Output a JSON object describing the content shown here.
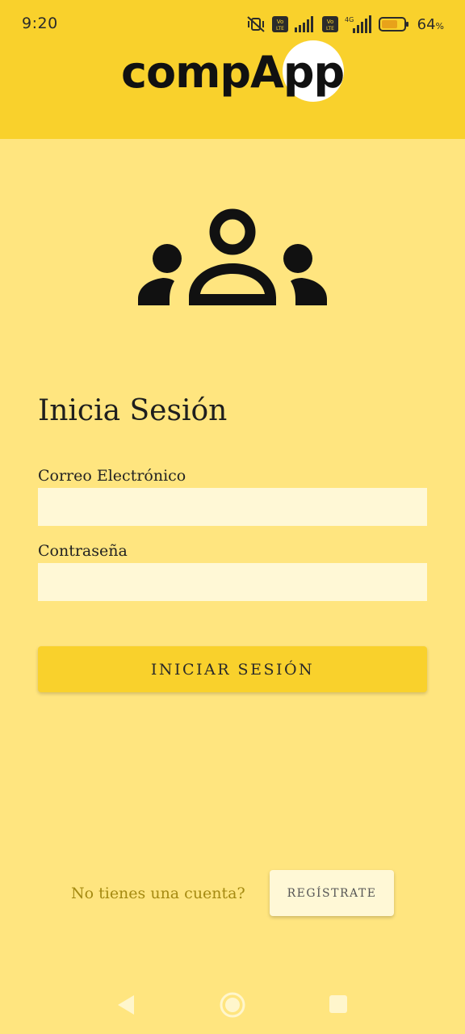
{
  "status_bar": {
    "time": "9:20",
    "battery_percent": "64",
    "battery_suffix": "%",
    "icons": [
      "mute-vibrate-icon",
      "volte-icon",
      "signal-icon",
      "volte-icon",
      "4g-signal-icon",
      "battery-icon"
    ]
  },
  "header": {
    "logo_text": "compApp",
    "background_color": "#F9D12C"
  },
  "hero": {
    "icon": "users-group-icon"
  },
  "login": {
    "title": "Inicia Sesión",
    "email_label": "Correo Electrónico",
    "email_value": "",
    "password_label": "Contraseña",
    "password_value": "",
    "submit_label": "INICIAR SESIÓN"
  },
  "register": {
    "prompt": "No tienes una cuenta?",
    "button_label": "REGÍSTRATE"
  },
  "nav": {
    "back_icon": "back-triangle-icon",
    "home_icon": "home-circle-icon",
    "recent_icon": "recents-square-icon"
  },
  "colors": {
    "page_background": "#FFE57F",
    "primary": "#F9D12C",
    "field_background": "#FFF8D6",
    "secondary_text": "#A58A12"
  }
}
